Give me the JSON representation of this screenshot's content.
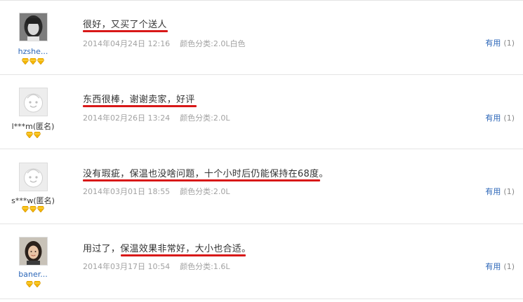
{
  "reviews": [
    {
      "username": "hzshe...",
      "comment": "很好，又买了个送人",
      "date": "2014年04月24日 12:16",
      "attr": "颜色分类:2.0L白色",
      "useful_label": "有用",
      "useful_count": "(1)",
      "badge_count": 3,
      "avatar": "photo-woman-bw"
    },
    {
      "username": "l***m(匿名)",
      "comment": "东西很棒，谢谢卖家，好评",
      "date": "2014年02月26日 13:24",
      "attr": "颜色分类:2.0L",
      "useful_label": "有用",
      "useful_count": "(1)",
      "badge_count": 2,
      "avatar": "default-face"
    },
    {
      "username": "s***w(匿名)",
      "comment": "没有瑕疵，保温也没啥问题，十个小时后仍能保持在68度。",
      "date": "2014年03月01日 18:55",
      "attr": "颜色分类:2.0L",
      "useful_label": "有用",
      "useful_count": "(1)",
      "badge_count": 3,
      "avatar": "default-face"
    },
    {
      "username": "baner...",
      "comment": "用过了，保温效果非常好，大小也合适。",
      "date": "2014年03月17日 10:54",
      "attr": "颜色分类:1.6L",
      "useful_label": "有用",
      "useful_count": "(1)",
      "badge_count": 2,
      "avatar": "photo-woman-color"
    }
  ],
  "colors": {
    "link": "#2b66b8",
    "underline": "#d81818",
    "meta": "#a2a2a2",
    "badge": "#f5b800"
  }
}
